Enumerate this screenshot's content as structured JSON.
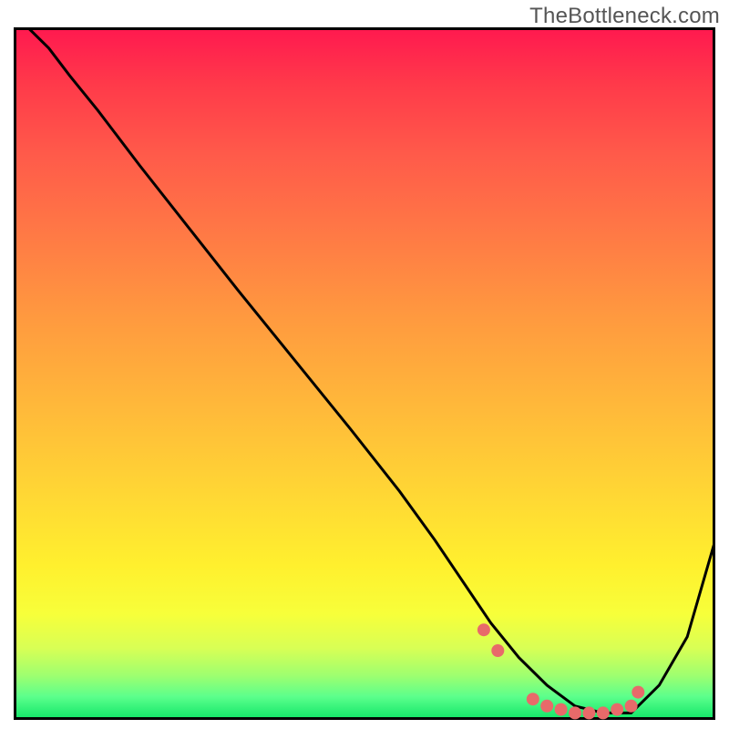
{
  "watermark": "TheBottleneck.com",
  "chart_data": {
    "type": "line",
    "title": "",
    "xlabel": "",
    "ylabel": "",
    "xlim": [
      0,
      100
    ],
    "ylim": [
      0,
      100
    ],
    "series": [
      {
        "name": "curve",
        "x": [
          2,
          5,
          8,
          12,
          18,
          25,
          32,
          40,
          48,
          55,
          60,
          64,
          68,
          72,
          76,
          80,
          84,
          88,
          92,
          96,
          100
        ],
        "y": [
          100,
          97,
          93,
          88,
          80,
          71,
          62,
          52,
          42,
          33,
          26,
          20,
          14,
          9,
          5,
          2,
          1,
          1,
          5,
          12,
          26
        ]
      }
    ],
    "markers": {
      "name": "highlight-dots",
      "color": "#e86a6a",
      "x": [
        67,
        69,
        74,
        76,
        78,
        80,
        82,
        84,
        86,
        88,
        89
      ],
      "y": [
        13,
        10,
        3,
        2,
        1.5,
        1,
        1,
        1,
        1.5,
        2,
        4
      ]
    },
    "background": "red-yellow-green vertical gradient"
  }
}
